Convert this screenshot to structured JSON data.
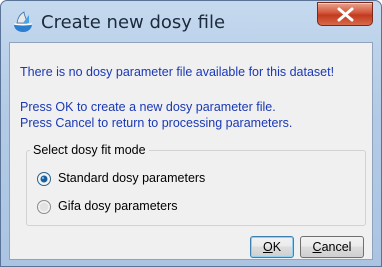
{
  "window": {
    "title": "Create new dosy file",
    "icon": "topspin-app-icon",
    "close_icon": "close-x-icon"
  },
  "message": {
    "line1": "There is no dosy parameter file available for this dataset!",
    "line2": "Press OK to create a new dosy parameter file.",
    "line3": "Press Cancel to return to processing parameters."
  },
  "fit_mode": {
    "group_title": "Select dosy fit mode",
    "options": [
      {
        "label": "Standard dosy parameters",
        "selected": true
      },
      {
        "label": "Gifa dosy parameters",
        "selected": false
      }
    ]
  },
  "buttons": {
    "ok_mnemonic": "O",
    "ok_rest": "K",
    "cancel_mnemonic": "C",
    "cancel_rest": "ancel"
  },
  "colors": {
    "message_text": "#1a38b5",
    "close_button": "#c13a1e",
    "window_frame": "#b3cbe6"
  }
}
